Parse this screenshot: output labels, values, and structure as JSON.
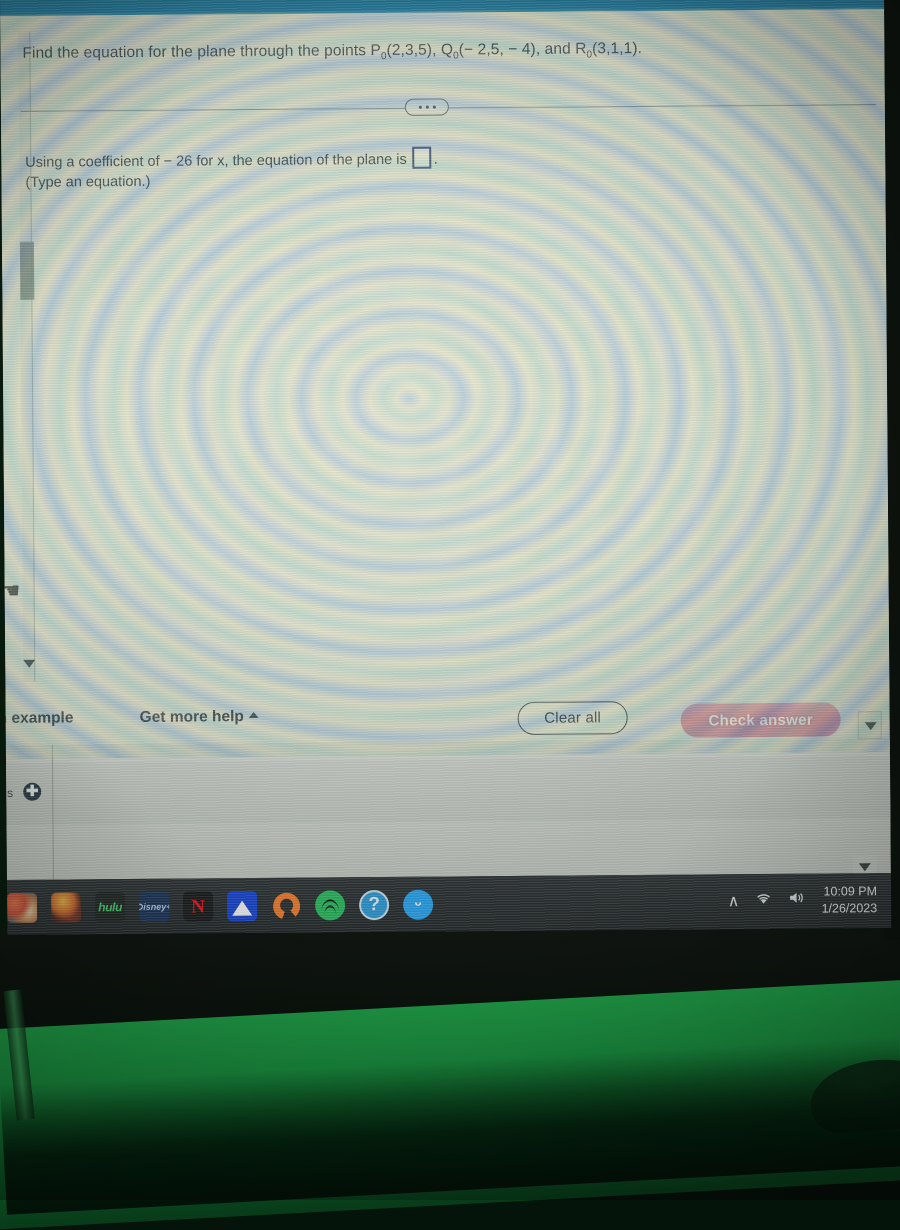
{
  "scene": {
    "description": "photo-of-monitor",
    "desk_color": "#1f9a46",
    "bezel_color": "#0b120c"
  },
  "window": {
    "topband_color": "#16739a",
    "page_bg": "#dcddd5"
  },
  "question": {
    "prompt_prefix": "Find the equation for the plane through the points ",
    "point_p_label": "P",
    "point_p_sub": "0",
    "point_p_coords": "(2,3,5), ",
    "point_q_label": "Q",
    "point_q_sub": "0",
    "point_q_coords": "(− 2,5, − 4), and ",
    "point_r_label": "R",
    "point_r_sub": "0",
    "point_r_coords": "(3,1,1)."
  },
  "answer": {
    "line_prefix": "Using a coefficient of ",
    "coefficient": "− 26",
    "line_middle": " for x, the equation of the plane is",
    "trailing_period": ".",
    "input_value": "",
    "hint": "(Type an equation.)"
  },
  "toolbar": {
    "view_example_label": "n example",
    "get_more_help_label": "Get more help",
    "clear_all_label": "Clear all",
    "check_answer_label": "Check answer",
    "check_answer_color": "#cf8496"
  },
  "lower_panel": {
    "tab_label": "os",
    "new_tab_icon": "✚"
  },
  "expander": {
    "icon_name": "ellipsis-pill",
    "dots": 3
  },
  "cursor": {
    "glyph": "☚",
    "type": "hand-pointer"
  },
  "taskbar": {
    "apps": [
      {
        "name": "photo-thumb-1",
        "label": "",
        "class": "photo1"
      },
      {
        "name": "photo-thumb-2",
        "label": "",
        "class": "photo2"
      },
      {
        "name": "hulu",
        "label": "hulu",
        "class": "hulu"
      },
      {
        "name": "disney-plus",
        "label": "Disney+",
        "class": "disney"
      },
      {
        "name": "netflix",
        "label": "N",
        "class": "netflix"
      },
      {
        "name": "paramount-plus",
        "label": "",
        "class": "paramount"
      },
      {
        "name": "crunchyroll",
        "label": "",
        "class": "crunchy"
      },
      {
        "name": "spotify",
        "label": "",
        "class": "spotify"
      },
      {
        "name": "help",
        "label": "?",
        "class": "help"
      },
      {
        "name": "twitter",
        "label": "ᵕ",
        "class": "twitter"
      }
    ],
    "tray": {
      "chevron_up": "∧",
      "wifi": "◠",
      "volume": "ὐA"
    },
    "clock": {
      "time": "10:09 PM",
      "date": "1/26/2023"
    }
  }
}
